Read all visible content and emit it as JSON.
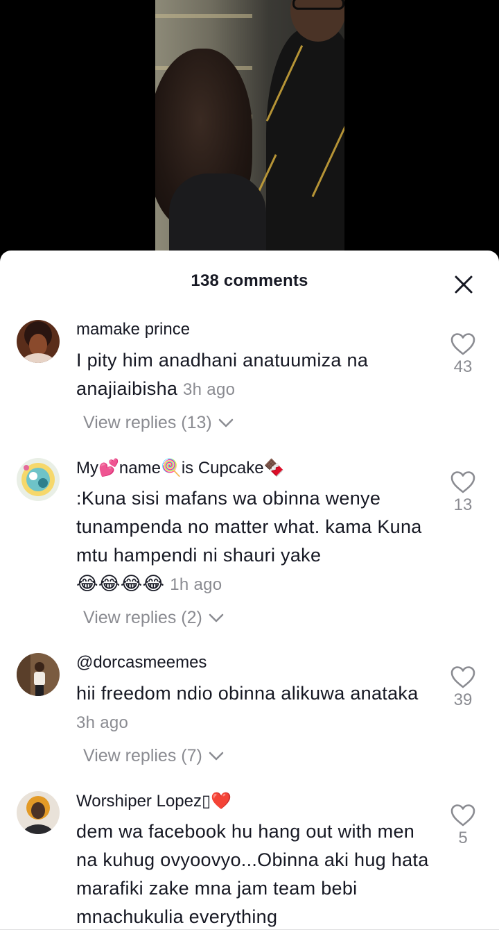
{
  "header": {
    "title": "138 comments",
    "close_icon": "close-icon"
  },
  "comments": [
    {
      "username": "mamake prince",
      "username_emoji": "",
      "text": "I pity him anadhani anatuumiza na anajiaibisha",
      "time": "3h ago",
      "likes": "43",
      "replies": "View replies (13)",
      "avatar_colors": [
        "#3a2015",
        "#c76b3b"
      ]
    },
    {
      "username_parts": [
        "My",
        "💕",
        "name",
        "🍭",
        "is Cupcake",
        "🍫"
      ],
      "text": ":Kuna sisi mafans wa obinna wenye tunampenda no matter what. kama Kuna mtu hampendi ni shauri yake",
      "emoji_line": "😂😂😂😂",
      "time": "1h ago",
      "likes": "13",
      "replies": "View replies (2)",
      "avatar_colors": [
        "#e8f1e9",
        "#4aa3a3"
      ]
    },
    {
      "username": "@dorcasmeemes",
      "text": "hii freedom ndio obinna alikuwa anataka",
      "time": "3h ago",
      "likes": "39",
      "replies": "View replies (7)",
      "avatar_colors": [
        "#6b5038",
        "#eae4db"
      ]
    },
    {
      "username": "Worshiper Lopez",
      "username_suffix": "▯❤️",
      "text": "dem wa facebook hu hang out with men na kuhug ovyoovyo...Obinna aki hug hata marafiki zake mna jam team bebi mnachukulia everything",
      "likes": "5",
      "avatar_colors": [
        "#e39a26",
        "#3b2a1f"
      ]
    }
  ],
  "icons": {
    "like": "heart-outline-icon",
    "chevron": "chevron-down-icon"
  },
  "colors": {
    "primary_text": "#161823",
    "secondary_text": "#8a8b91",
    "sheet_bg": "#ffffff"
  }
}
